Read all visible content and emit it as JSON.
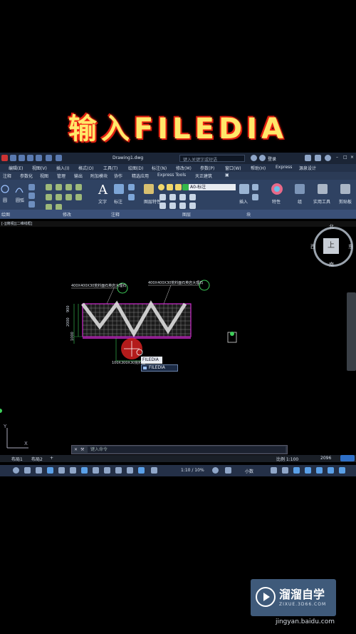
{
  "headline": "输入FILEDIA",
  "titlebar": {
    "doc": "Drawing1.dwg",
    "search_placeholder": "键入关键字或短语",
    "login": "登录"
  },
  "menu": [
    "编辑(E)",
    "视图(V)",
    "插入(I)",
    "格式(O)",
    "工具(T)",
    "绘图(D)",
    "标注(N)",
    "修改(M)",
    "参数(P)",
    "窗口(W)",
    "帮助(H)",
    "Express",
    "源泉设计"
  ],
  "ribbon_tabs": [
    "注释",
    "参数化",
    "视图",
    "管理",
    "输出",
    "附加模块",
    "协作",
    "精选应用",
    "Express Tools",
    "天正建筑"
  ],
  "ribbon": {
    "draw_labels": [
      "圆",
      "圆弧"
    ],
    "text_label": "文字",
    "dim_label": "标注",
    "layer_props_label": "图层特性",
    "layer_current": "A0-标注",
    "insert_label": "插入",
    "props_label": "特性",
    "group_label": "组",
    "utils_label": "实用工具",
    "clipboard_label": "剪贴板",
    "panel_draw": "绘图",
    "panel_modify": "修改",
    "panel_annot": "注释",
    "panel_layer": "图层",
    "panel_block": "块"
  },
  "drawing_tab": "[-][俯视][二维线框]",
  "compass": {
    "north": "北",
    "south": "南",
    "east": "东",
    "west": "西",
    "top": "上"
  },
  "drawing": {
    "label_left": "400X400X30荒料面石英岩大理石",
    "label_right": "400X400X30荒料面石英岩大理石",
    "label_bottom": "100X300X30荒料面",
    "dim1": "900",
    "dim2": "2000",
    "dim3": "1000"
  },
  "autocomplete": {
    "typed": "FILEDIA",
    "suggestion": "FILEDIA"
  },
  "command_placeholder": "键入命令",
  "layout_tabs": [
    "布局1",
    "布局2",
    "+"
  ],
  "status": {
    "scale": "比例 1:100",
    "value": "2096",
    "annot_scale": "1:10 / 10%",
    "units": "小数"
  },
  "watermark": {
    "brand": "溜溜自学",
    "sub": "ZIXUE.3D66.COM",
    "url": "jingyan.baidu.com"
  }
}
